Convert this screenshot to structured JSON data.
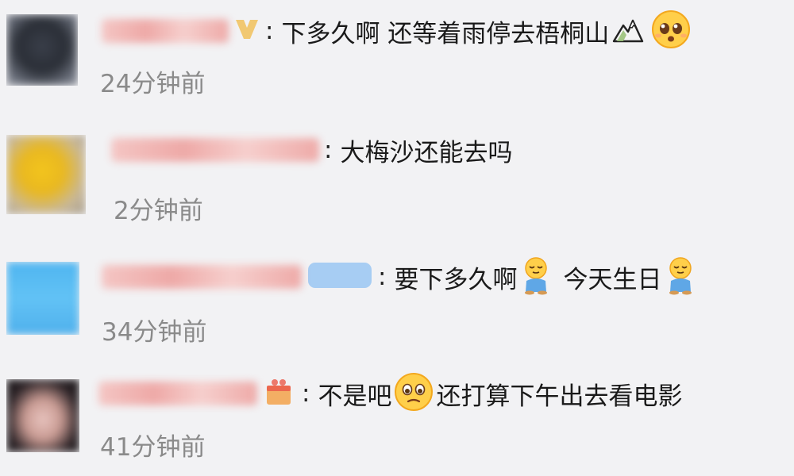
{
  "comments": [
    {
      "text_parts": [
        "下多久啊 还等着雨停去梧桐山"
      ],
      "time": "24分钟前",
      "emoji_names": [
        "mountain-emoji",
        "pleading-face-emoji"
      ]
    },
    {
      "text_parts": [
        "大梅沙还能去吗"
      ],
      "time": "2分钟前",
      "emoji_names": []
    },
    {
      "text_parts": [
        "要下多久啊",
        "今天生日"
      ],
      "time": "34分钟前",
      "emoji_names": [
        "sleepy-sitting-emoji",
        "sleepy-sitting-emoji"
      ]
    },
    {
      "text_parts": [
        "不是吧",
        "还打算下午出去看电影"
      ],
      "time": "41分钟前",
      "emoji_names": [
        "worried-face-emoji"
      ]
    }
  ],
  "colors": {
    "background": "#f2f2f4",
    "username_blur": "#eea9a7",
    "timestamp": "#8a8a8a",
    "text": "#1a1a1a"
  }
}
